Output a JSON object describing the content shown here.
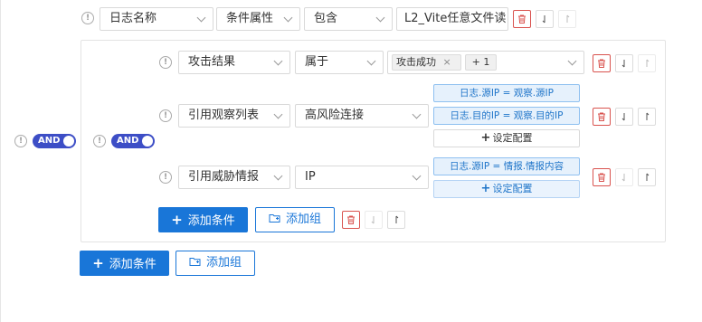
{
  "top_row": {
    "field": "日志名称",
    "operator_type": "条件属性",
    "operator": "包含",
    "value": "L2_Vite任意文件读"
  },
  "outer_group": {
    "logic": "AND"
  },
  "inner_group": {
    "logic": "AND",
    "rows": [
      {
        "field": "攻击结果",
        "operator": "属于",
        "tags": [
          "攻击成功",
          "+ 1"
        ]
      },
      {
        "field": "引用观察列表",
        "operator": "高风险连接",
        "mappings": [
          "日志.源IP = 观察.源IP",
          "日志.目的IP = 观察.目的IP"
        ],
        "config_label": "设定配置"
      },
      {
        "field": "引用威胁情报",
        "operator": "IP",
        "mappings": [
          "日志.源IP = 情报.情报内容"
        ],
        "config_label": "设定配置"
      }
    ],
    "add_condition_label": "添加条件",
    "add_group_label": "添加组"
  },
  "bottom": {
    "add_condition_label": "添加条件",
    "add_group_label": "添加组"
  },
  "colors": {
    "primary": "#1976d8",
    "toggle": "#3d4ec6",
    "delete": "#d9534f",
    "tag_blue": "#1f75c9"
  }
}
